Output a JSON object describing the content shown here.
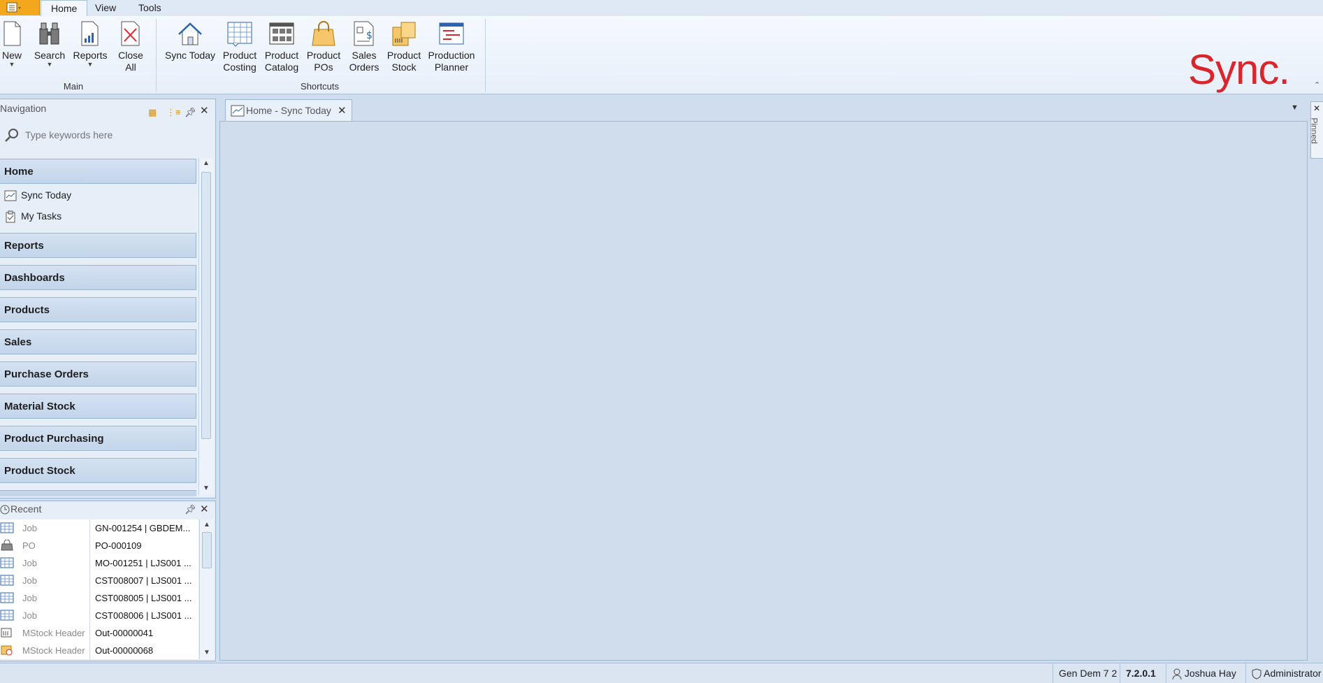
{
  "ribbon_tabs": [
    "Home",
    "View",
    "Tools"
  ],
  "groups": {
    "main_label": "Main",
    "shortcuts_label": "Shortcuts"
  },
  "main_buttons": [
    {
      "label1": "New",
      "label2": "",
      "has_dropdown": true
    },
    {
      "label1": "Search",
      "label2": "",
      "has_dropdown": true
    },
    {
      "label1": "Reports",
      "label2": "",
      "has_dropdown": true
    },
    {
      "label1": "Close",
      "label2": "All",
      "has_dropdown": false
    }
  ],
  "shortcut_buttons": [
    {
      "label1": "Sync Today",
      "label2": ""
    },
    {
      "label1": "Product",
      "label2": "Costing"
    },
    {
      "label1": "Product",
      "label2": "Catalog"
    },
    {
      "label1": "Product",
      "label2": "POs"
    },
    {
      "label1": "Sales",
      "label2": "Orders"
    },
    {
      "label1": "Product",
      "label2": "Stock"
    },
    {
      "label1": "Production",
      "label2": "Planner"
    }
  ],
  "logo_text": "Sync.",
  "navigation": {
    "title": "Navigation",
    "search_placeholder": "Type keywords here",
    "home_section": "Home",
    "home_items": [
      "Sync Today",
      "My Tasks"
    ],
    "sections": [
      "Reports",
      "Dashboards",
      "Products",
      "Sales",
      "Purchase Orders",
      "Material Stock",
      "Product Purchasing",
      "Product Stock"
    ]
  },
  "recent": {
    "title": "Recent",
    "rows": [
      {
        "type": "Job",
        "value": "GN-001254 | GBDEM..."
      },
      {
        "type": "PO",
        "value": "PO-000109"
      },
      {
        "type": "Job",
        "value": "MO-001251 | LJS001 ..."
      },
      {
        "type": "Job",
        "value": "CST008007 | LJS001 ..."
      },
      {
        "type": "Job",
        "value": "CST008005 | LJS001 ..."
      },
      {
        "type": "Job",
        "value": "CST008006 | LJS001 ..."
      },
      {
        "type": "MStock Header",
        "value": "Out-00000041"
      },
      {
        "type": "MStock Header",
        "value": "Out-00000068"
      }
    ]
  },
  "document_tab": "Home - Sync Today",
  "pinned_label": "Pinned",
  "status": {
    "database": "Gen Dem 7 2",
    "version": "7.2.0.1",
    "user": "Joshua Hay",
    "role": "Administrator"
  },
  "colors": {
    "logo": "#d9252b",
    "app_button": "#f3a71c"
  }
}
